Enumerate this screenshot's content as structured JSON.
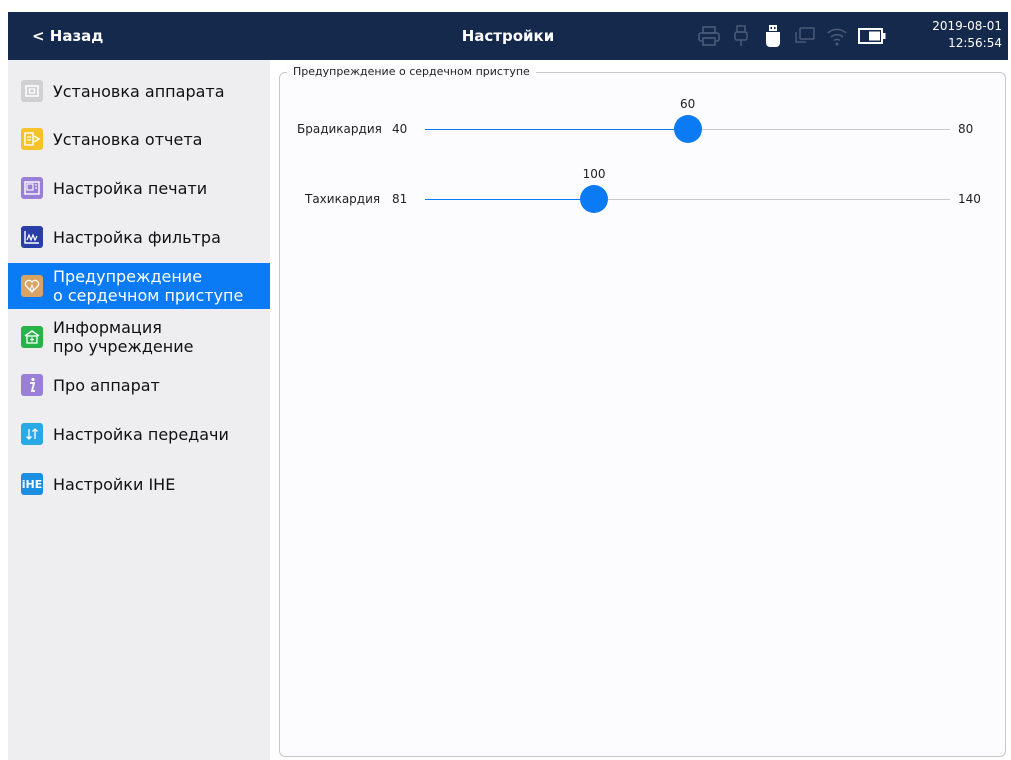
{
  "header": {
    "back_label": "< Назад",
    "title": "Настройки",
    "date": "2019-08-01",
    "time": "12:56:54",
    "status_icons": [
      "printer-icon",
      "usb-plug-icon",
      "usb-drive-icon",
      "network-icon",
      "wifi-icon",
      "battery-icon"
    ]
  },
  "sidebar": {
    "items": [
      {
        "label": "Установка аппарата",
        "icon": "device-setup-icon",
        "color": "#d0d0d3"
      },
      {
        "label": "Установка отчета",
        "icon": "report-icon",
        "color": "#f5c22a"
      },
      {
        "label": "Настройка печати",
        "icon": "print-settings-icon",
        "color": "#9a7fd6"
      },
      {
        "label": "Настройка фильтра",
        "icon": "filter-icon",
        "color": "#2a3ea8"
      },
      {
        "label_line1": "Предупреждение",
        "label_line2": "о сердечном приступе",
        "icon": "heart-alert-icon",
        "color": "#d9a366",
        "active": true
      },
      {
        "label_line1": "Информация",
        "label_line2": "про учреждение",
        "icon": "institution-icon",
        "color": "#27b34a"
      },
      {
        "label": "Про аппарат",
        "icon": "info-icon",
        "color": "#9a7fd6"
      },
      {
        "label": "Настройка передачи",
        "icon": "transfer-icon",
        "color": "#29a9e6"
      },
      {
        "label": "Настройки IHE",
        "icon": "ihe-icon",
        "color": "#1a8ee0",
        "icon_text": "iHE"
      }
    ]
  },
  "panel": {
    "title": "Предупреждение о сердечном приступе",
    "sliders": [
      {
        "label": "Брадикардия",
        "min": 40,
        "max": 80,
        "value": 60
      },
      {
        "label": "Тахикардия",
        "min": 81,
        "max": 140,
        "value": 100
      }
    ]
  },
  "colors": {
    "accent": "#0a7bf5",
    "header_bg": "#15294c",
    "sidebar_bg": "#eeedef"
  }
}
